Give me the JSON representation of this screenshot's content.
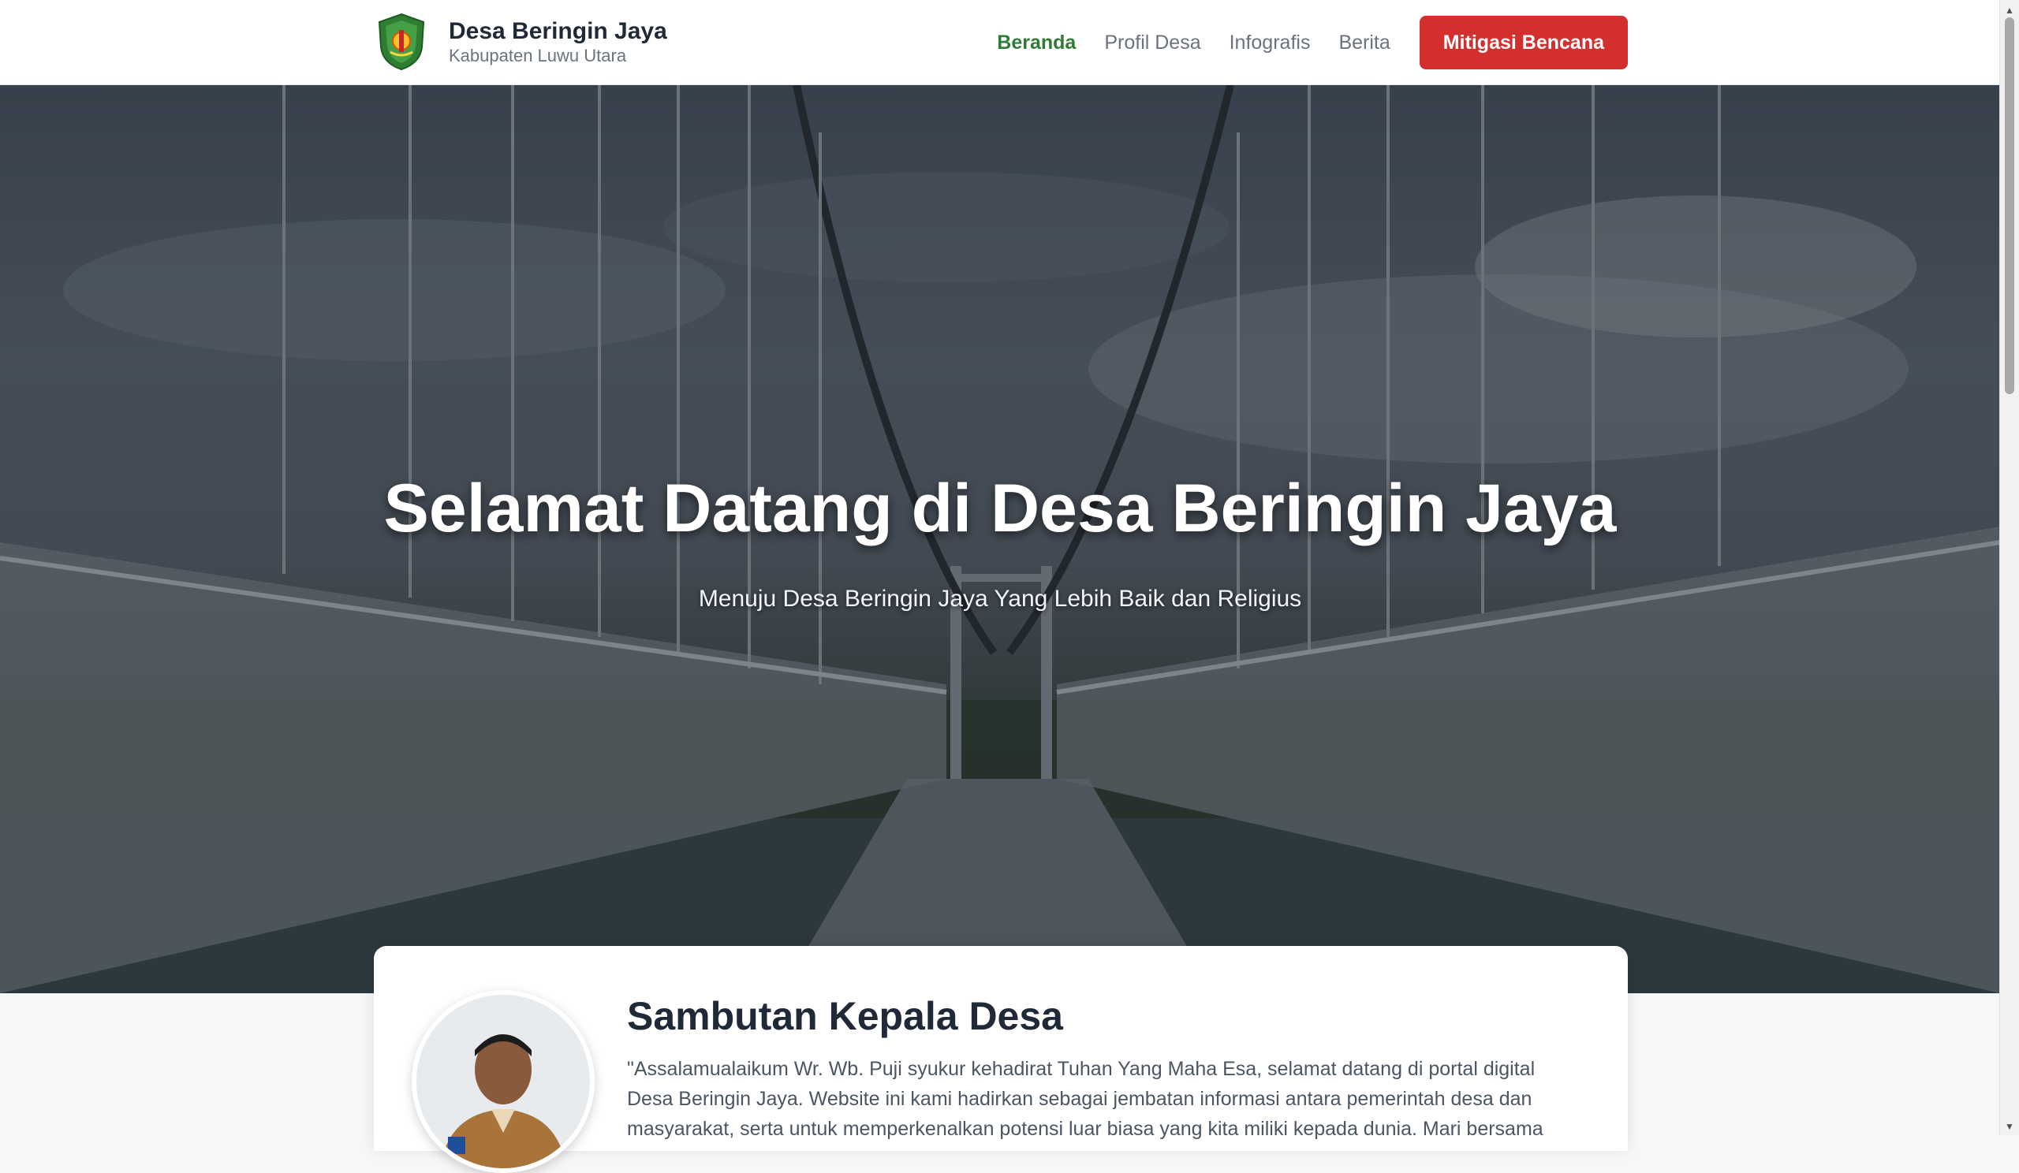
{
  "header": {
    "site_title": "Desa Beringin Jaya",
    "site_subtitle": "Kabupaten Luwu Utara",
    "logo_icon": "regency-emblem-icon",
    "nav": [
      {
        "label": "Beranda",
        "active": true
      },
      {
        "label": "Profil Desa",
        "active": false
      },
      {
        "label": "Infografis",
        "active": false
      },
      {
        "label": "Berita",
        "active": false
      }
    ],
    "cta_label": "Mitigasi Bencana"
  },
  "hero": {
    "title": "Selamat Datang di Desa Beringin Jaya",
    "subtitle": "Menuju Desa Beringin Jaya Yang Lebih Baik dan Religius"
  },
  "welcome": {
    "title": "Sambutan Kepala Desa",
    "text": "\"Assalamualaikum Wr. Wb. Puji syukur kehadirat Tuhan Yang Maha Esa, selamat datang di portal digital Desa Beringin Jaya. Website ini kami hadirkan sebagai jembatan informasi antara pemerintah desa dan masyarakat, serta untuk memperkenalkan potensi luar biasa yang kita miliki kepada dunia. Mari bersama"
  },
  "colors": {
    "nav_active": "#2e7d32",
    "cta_background": "#d32f2f"
  }
}
